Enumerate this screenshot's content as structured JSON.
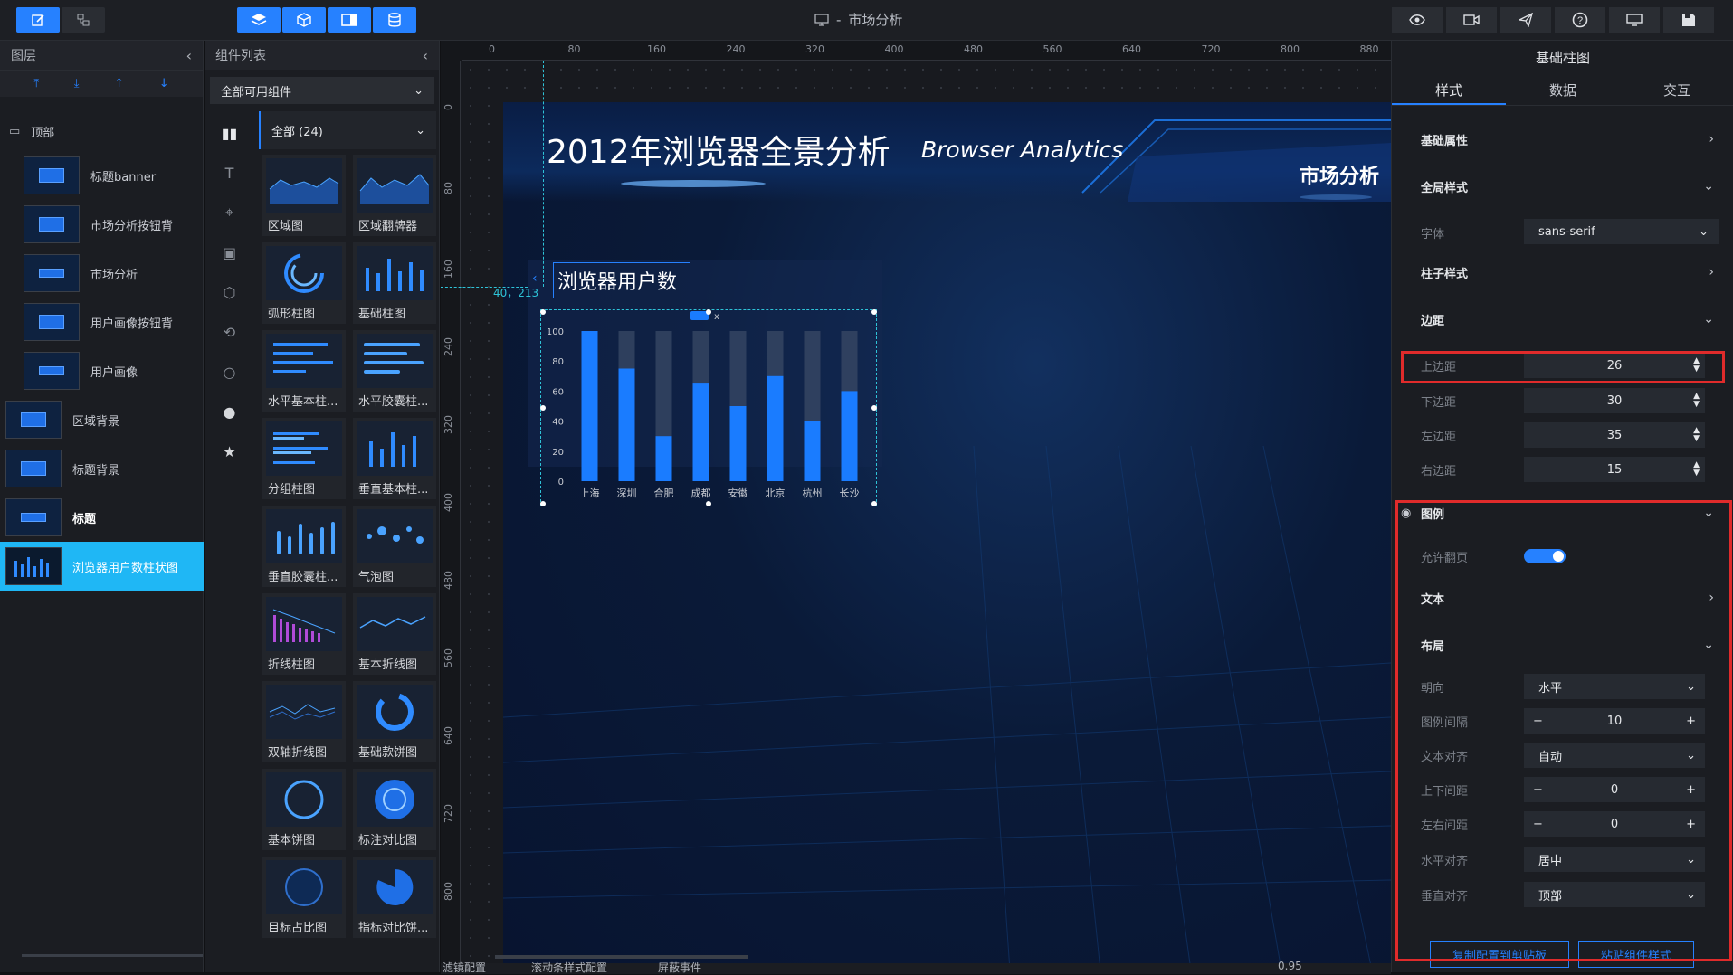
{
  "window": {
    "title": "市场分析"
  },
  "topbar": {
    "left_tools": [
      "edit-icon",
      "share-icon"
    ],
    "mid_tools": [
      "layers-icon",
      "cube-icon",
      "panel-icon",
      "database-icon"
    ],
    "right_tools": [
      "preview-icon",
      "record-icon",
      "publish-icon",
      "help-icon",
      "screen-icon",
      "save-icon"
    ]
  },
  "layers": {
    "title": "图层",
    "root": "顶部",
    "items": [
      "标题banner",
      "市场分析按钮背",
      "市场分析",
      "用户画像按钮背",
      "用户画像",
      "区域背景",
      "标题背景",
      "标题",
      "浏览器用户数柱状图"
    ]
  },
  "components": {
    "title": "组件列表",
    "filter": "全部可用组件",
    "category": "全部 (24)",
    "cards": [
      "区域图",
      "区域翻牌器",
      "弧形柱图",
      "基础柱图",
      "水平基本柱...",
      "水平胶囊柱...",
      "分组柱图",
      "垂直基本柱...",
      "垂直胶囊柱...",
      "气泡图",
      "折线柱图",
      "基本折线图",
      "双轴折线图",
      "基础款饼图",
      "基本饼图",
      "标注对比图",
      "目标占比图",
      "指标对比饼..."
    ]
  },
  "ruler": {
    "top": [
      "0",
      "80",
      "160",
      "240",
      "320",
      "400",
      "480",
      "560",
      "640",
      "720",
      "800",
      "880"
    ],
    "left": [
      "0",
      "80",
      "160",
      "240",
      "320",
      "400",
      "480",
      "560",
      "640",
      "720",
      "800"
    ],
    "coord_readout": "40，213"
  },
  "screen": {
    "title": "2012年浏览器全景分析",
    "subtitle": "Browser Analytics",
    "tab": "市场分析",
    "panel_title": "浏览器用户数",
    "legend_marker": "x"
  },
  "chart_data": {
    "type": "bar",
    "categories": [
      "上海",
      "深圳",
      "合肥",
      "成都",
      "安徽",
      "北京",
      "杭州",
      "长沙"
    ],
    "values": [
      100,
      75,
      30,
      65,
      50,
      70,
      40,
      60
    ],
    "background_max": 100,
    "ylim": [
      0,
      100
    ],
    "yticks": [
      "0",
      "20",
      "40",
      "60",
      "80",
      "100"
    ],
    "bar_color": "#1a7cff"
  },
  "properties": {
    "title": "基础柱图",
    "tabs": [
      "样式",
      "数据",
      "交互"
    ],
    "basic": "基础属性",
    "global_style": "全局样式",
    "font_label": "字体",
    "font_value": "sans-serif",
    "bar_style": "柱子样式",
    "margin": "边距",
    "margin_top_label": "上边距",
    "margin_top": "26",
    "margin_bottom_label": "下边距",
    "margin_bottom": "30",
    "margin_left_label": "左边距",
    "margin_left": "35",
    "margin_right_label": "右边距",
    "margin_right": "15",
    "legend": "图例",
    "paging_label": "允许翻页",
    "text": "文本",
    "layout": "布局",
    "orient_label": "朝向",
    "orient_value": "水平",
    "gap_label": "图例间隔",
    "gap_value": "10",
    "text_align_label": "文本对齐",
    "text_align_value": "自动",
    "vgap_label": "上下间距",
    "vgap_value": "0",
    "hgap_label": "左右间距",
    "hgap_value": "0",
    "halign_label": "水平对齐",
    "halign_value": "居中",
    "valign_label": "垂直对齐",
    "valign_value": "顶部",
    "copy_btn": "复制配置到剪贴板",
    "paste_btn": "粘贴组件样式"
  },
  "bottom": {
    "filter_config": "滤镜配置",
    "scroll_config": "滚动条样式配置",
    "shield_event": "屏蔽事件",
    "zoom": "0.95"
  },
  "colors": {
    "accent": "#2681ff",
    "highlight": "#e02b2b",
    "selected_layer": "#1fb7f5"
  }
}
